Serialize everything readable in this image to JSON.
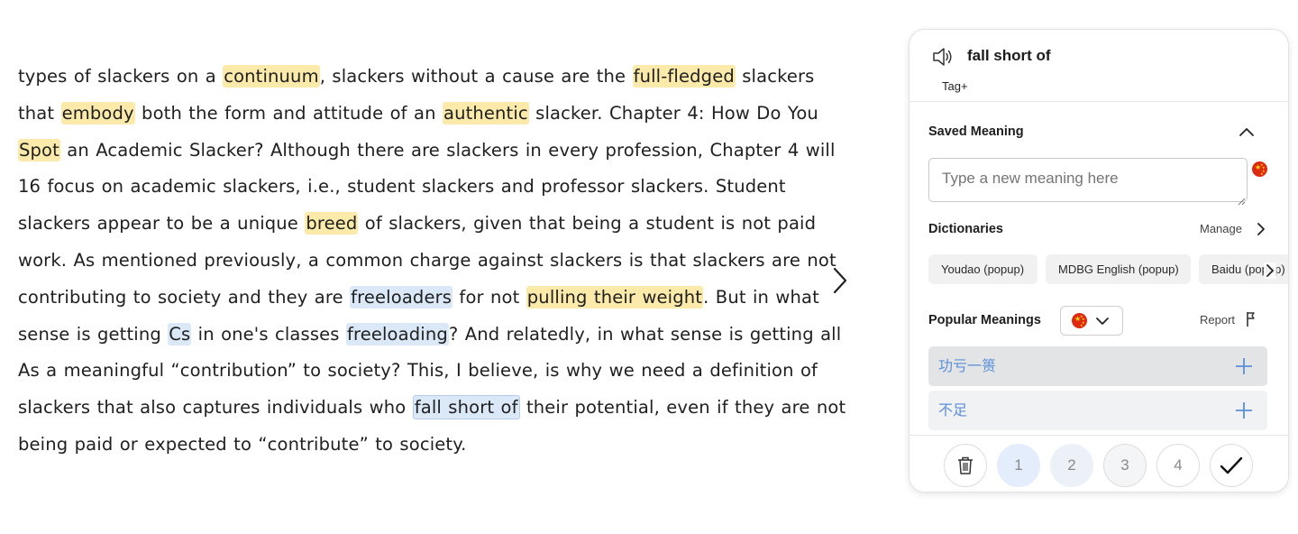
{
  "reader": {
    "lines": [
      [
        {
          "t": "types of slackers on a "
        },
        {
          "t": "continuum",
          "h": "y"
        },
        {
          "t": ", slackers without a cause are the "
        },
        {
          "t": "full-fledged",
          "h": "y"
        },
        {
          "t": " slackers"
        }
      ],
      [
        {
          "t": "that "
        },
        {
          "t": "embody",
          "h": "y"
        },
        {
          "t": " both the form and attitude of an "
        },
        {
          "t": "authentic",
          "h": "y"
        },
        {
          "t": " slacker. Chapter 4: How Do You"
        }
      ],
      [
        {
          "t": "Spot",
          "h": "y"
        },
        {
          "t": " an Academic Slacker? Although there are slackers in every profession, Chapter 4 will"
        }
      ],
      [
        {
          "t": "16 focus on academic slackers, i.e., student slackers and professor slackers. Student"
        }
      ],
      [
        {
          "t": "slackers appear to be a unique "
        },
        {
          "t": "breed",
          "h": "y"
        },
        {
          "t": " of slackers, given that being a student is not paid"
        }
      ],
      [
        {
          "t": "work. As mentioned previously, a common charge against slackers is that slackers are not"
        }
      ],
      [
        {
          "t": "contributing to society and they are "
        },
        {
          "t": "freeloaders",
          "h": "b"
        },
        {
          "t": " for not "
        },
        {
          "t": "pulling their weight",
          "h": "y"
        },
        {
          "t": ". But in what"
        }
      ],
      [
        {
          "t": "sense is getting "
        },
        {
          "t": "Cs",
          "h": "b"
        },
        {
          "t": " in one's classes "
        },
        {
          "t": "freeloading",
          "h": "b"
        },
        {
          "t": "? And relatedly, in what sense is getting all"
        }
      ],
      [
        {
          "t": "As a meaningful “contribution” to society? This, I believe, is why we need a definition of"
        }
      ],
      [
        {
          "t": "slackers that also captures individuals who "
        },
        {
          "t": "fall short of",
          "h": "b",
          "active": true
        },
        {
          "t": " their potential, even if they are not"
        }
      ],
      [
        {
          "t": "being paid or expected to “contribute” to society."
        }
      ]
    ]
  },
  "panel": {
    "word": "fall short of",
    "tag_label": "Tag+",
    "saved_meaning": {
      "title": "Saved Meaning",
      "placeholder": "Type a new meaning here",
      "language_flag": "china-flag"
    },
    "dictionaries": {
      "title": "Dictionaries",
      "manage_label": "Manage",
      "items": [
        "Youdao (popup)",
        "MDBG English (popup)",
        "Baidu (popup)"
      ]
    },
    "popular_meanings": {
      "title": "Popular Meanings",
      "language_flag": "china-flag",
      "report_label": "Report",
      "items": [
        {
          "text": "功亏一篑",
          "bg": "#e3e4e6"
        },
        {
          "text": "不足",
          "bg": "#f1f2f3"
        }
      ]
    },
    "footer": {
      "levels": [
        "1",
        "2",
        "3",
        "4"
      ],
      "level_bgs": [
        "#e3edfb",
        "#ecf1f8",
        "#f4f5f7",
        "#ffffff"
      ]
    }
  },
  "colors": {
    "highlight_yellow": "#fbeaa9",
    "highlight_blue": "#dbe8f7",
    "meaning_text": "#5a8fd8",
    "flag_red": "#de2910"
  }
}
